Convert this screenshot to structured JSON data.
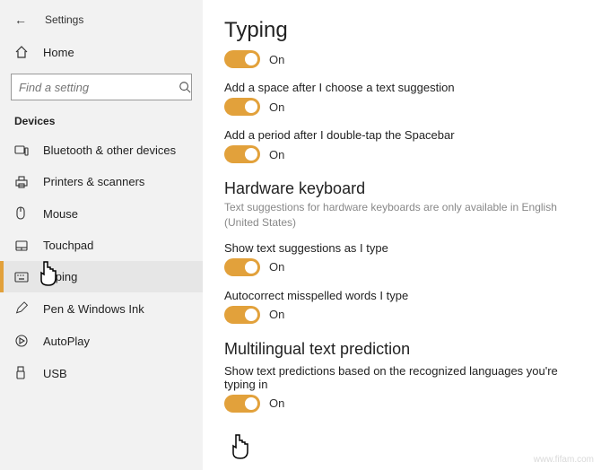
{
  "app": {
    "title": "Settings"
  },
  "home": {
    "label": "Home"
  },
  "search": {
    "placeholder": "Find a setting"
  },
  "sidebar": {
    "section": "Devices",
    "items": [
      {
        "label": "Bluetooth & other devices"
      },
      {
        "label": "Printers & scanners"
      },
      {
        "label": "Mouse"
      },
      {
        "label": "Touchpad"
      },
      {
        "label": "Typing"
      },
      {
        "label": "Pen & Windows Ink"
      },
      {
        "label": "AutoPlay"
      },
      {
        "label": "USB"
      }
    ]
  },
  "page": {
    "title": "Typing",
    "toggles": {
      "main": "On",
      "space": {
        "label": "Add a space after I choose a text suggestion",
        "state": "On"
      },
      "period": {
        "label": "Add a period after I double-tap the Spacebar",
        "state": "On"
      }
    },
    "hw": {
      "heading": "Hardware keyboard",
      "sub": "Text suggestions for hardware keyboards are only available in English (United States)",
      "suggest": {
        "label": "Show text suggestions as I type",
        "state": "On"
      },
      "autocorrect": {
        "label": "Autocorrect misspelled words I type",
        "state": "On"
      }
    },
    "multi": {
      "heading": "Multilingual text prediction",
      "label": "Show text predictions based on the recognized languages you're typing in",
      "state": "On"
    }
  },
  "watermark": "www.fifam.com"
}
